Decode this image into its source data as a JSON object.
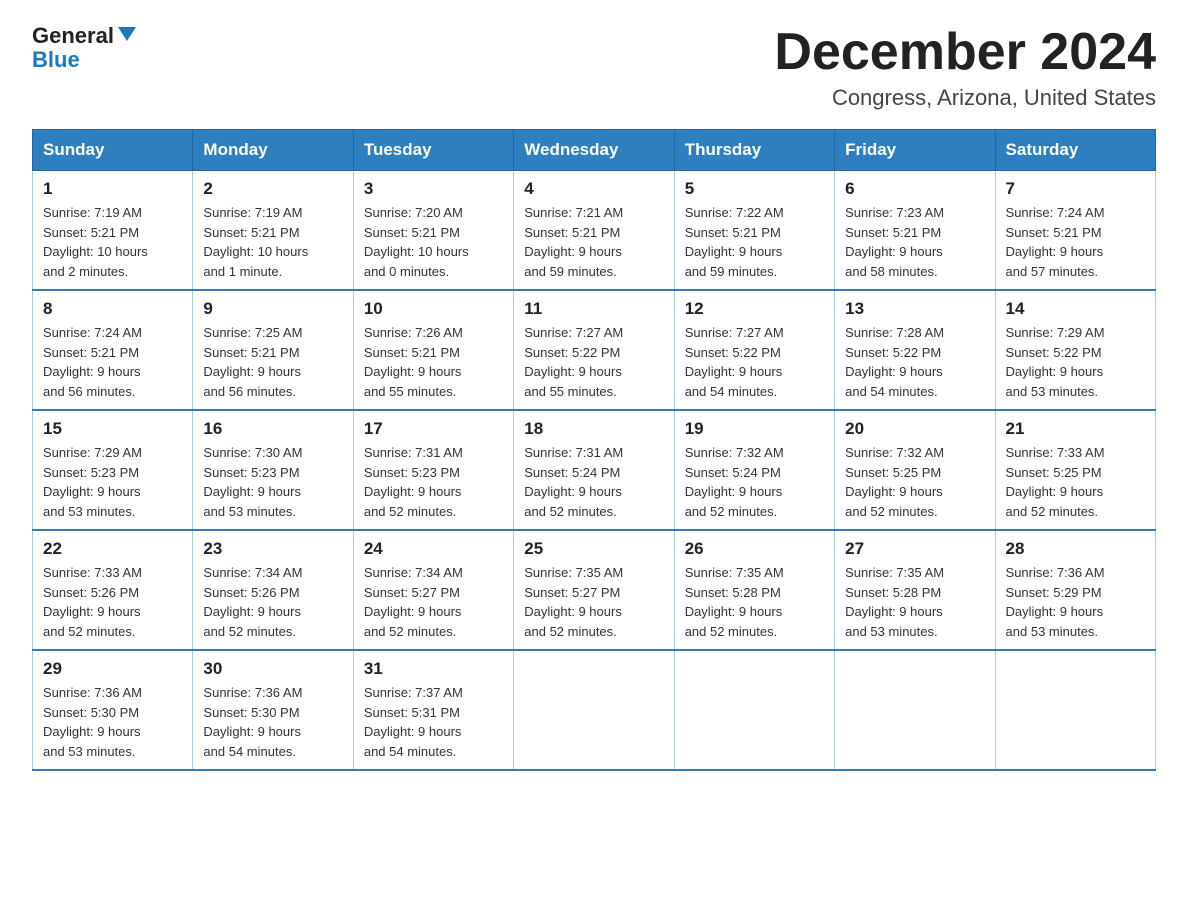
{
  "logo": {
    "text_general": "General",
    "text_blue": "Blue"
  },
  "title": "December 2024",
  "subtitle": "Congress, Arizona, United States",
  "days_header": [
    "Sunday",
    "Monday",
    "Tuesday",
    "Wednesday",
    "Thursday",
    "Friday",
    "Saturday"
  ],
  "weeks": [
    [
      {
        "num": "1",
        "info": "Sunrise: 7:19 AM\nSunset: 5:21 PM\nDaylight: 10 hours\nand 2 minutes."
      },
      {
        "num": "2",
        "info": "Sunrise: 7:19 AM\nSunset: 5:21 PM\nDaylight: 10 hours\nand 1 minute."
      },
      {
        "num": "3",
        "info": "Sunrise: 7:20 AM\nSunset: 5:21 PM\nDaylight: 10 hours\nand 0 minutes."
      },
      {
        "num": "4",
        "info": "Sunrise: 7:21 AM\nSunset: 5:21 PM\nDaylight: 9 hours\nand 59 minutes."
      },
      {
        "num": "5",
        "info": "Sunrise: 7:22 AM\nSunset: 5:21 PM\nDaylight: 9 hours\nand 59 minutes."
      },
      {
        "num": "6",
        "info": "Sunrise: 7:23 AM\nSunset: 5:21 PM\nDaylight: 9 hours\nand 58 minutes."
      },
      {
        "num": "7",
        "info": "Sunrise: 7:24 AM\nSunset: 5:21 PM\nDaylight: 9 hours\nand 57 minutes."
      }
    ],
    [
      {
        "num": "8",
        "info": "Sunrise: 7:24 AM\nSunset: 5:21 PM\nDaylight: 9 hours\nand 56 minutes."
      },
      {
        "num": "9",
        "info": "Sunrise: 7:25 AM\nSunset: 5:21 PM\nDaylight: 9 hours\nand 56 minutes."
      },
      {
        "num": "10",
        "info": "Sunrise: 7:26 AM\nSunset: 5:21 PM\nDaylight: 9 hours\nand 55 minutes."
      },
      {
        "num": "11",
        "info": "Sunrise: 7:27 AM\nSunset: 5:22 PM\nDaylight: 9 hours\nand 55 minutes."
      },
      {
        "num": "12",
        "info": "Sunrise: 7:27 AM\nSunset: 5:22 PM\nDaylight: 9 hours\nand 54 minutes."
      },
      {
        "num": "13",
        "info": "Sunrise: 7:28 AM\nSunset: 5:22 PM\nDaylight: 9 hours\nand 54 minutes."
      },
      {
        "num": "14",
        "info": "Sunrise: 7:29 AM\nSunset: 5:22 PM\nDaylight: 9 hours\nand 53 minutes."
      }
    ],
    [
      {
        "num": "15",
        "info": "Sunrise: 7:29 AM\nSunset: 5:23 PM\nDaylight: 9 hours\nand 53 minutes."
      },
      {
        "num": "16",
        "info": "Sunrise: 7:30 AM\nSunset: 5:23 PM\nDaylight: 9 hours\nand 53 minutes."
      },
      {
        "num": "17",
        "info": "Sunrise: 7:31 AM\nSunset: 5:23 PM\nDaylight: 9 hours\nand 52 minutes."
      },
      {
        "num": "18",
        "info": "Sunrise: 7:31 AM\nSunset: 5:24 PM\nDaylight: 9 hours\nand 52 minutes."
      },
      {
        "num": "19",
        "info": "Sunrise: 7:32 AM\nSunset: 5:24 PM\nDaylight: 9 hours\nand 52 minutes."
      },
      {
        "num": "20",
        "info": "Sunrise: 7:32 AM\nSunset: 5:25 PM\nDaylight: 9 hours\nand 52 minutes."
      },
      {
        "num": "21",
        "info": "Sunrise: 7:33 AM\nSunset: 5:25 PM\nDaylight: 9 hours\nand 52 minutes."
      }
    ],
    [
      {
        "num": "22",
        "info": "Sunrise: 7:33 AM\nSunset: 5:26 PM\nDaylight: 9 hours\nand 52 minutes."
      },
      {
        "num": "23",
        "info": "Sunrise: 7:34 AM\nSunset: 5:26 PM\nDaylight: 9 hours\nand 52 minutes."
      },
      {
        "num": "24",
        "info": "Sunrise: 7:34 AM\nSunset: 5:27 PM\nDaylight: 9 hours\nand 52 minutes."
      },
      {
        "num": "25",
        "info": "Sunrise: 7:35 AM\nSunset: 5:27 PM\nDaylight: 9 hours\nand 52 minutes."
      },
      {
        "num": "26",
        "info": "Sunrise: 7:35 AM\nSunset: 5:28 PM\nDaylight: 9 hours\nand 52 minutes."
      },
      {
        "num": "27",
        "info": "Sunrise: 7:35 AM\nSunset: 5:28 PM\nDaylight: 9 hours\nand 53 minutes."
      },
      {
        "num": "28",
        "info": "Sunrise: 7:36 AM\nSunset: 5:29 PM\nDaylight: 9 hours\nand 53 minutes."
      }
    ],
    [
      {
        "num": "29",
        "info": "Sunrise: 7:36 AM\nSunset: 5:30 PM\nDaylight: 9 hours\nand 53 minutes."
      },
      {
        "num": "30",
        "info": "Sunrise: 7:36 AM\nSunset: 5:30 PM\nDaylight: 9 hours\nand 54 minutes."
      },
      {
        "num": "31",
        "info": "Sunrise: 7:37 AM\nSunset: 5:31 PM\nDaylight: 9 hours\nand 54 minutes."
      },
      null,
      null,
      null,
      null
    ]
  ]
}
